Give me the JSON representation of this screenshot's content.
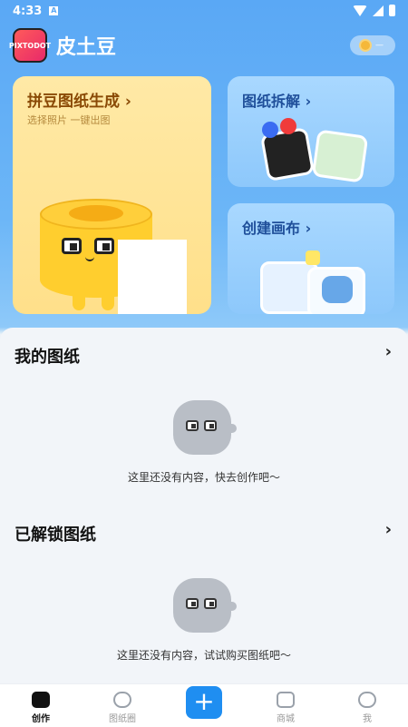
{
  "status_bar": {
    "time": "4:33",
    "sim_label": "A"
  },
  "header": {
    "logo_text_line1": "PIX",
    "logo_text_line2": "TO",
    "logo_text_line3": "DOT",
    "title": "皮土豆",
    "coin_text": "—"
  },
  "cards": {
    "generate": {
      "title": "拼豆图纸生成 ›",
      "subtitle": "选择照片 一键出图"
    },
    "disassemble": {
      "title": "图纸拆解 ›"
    },
    "create_canvas": {
      "title": "创建画布 ›"
    }
  },
  "my_drawings": {
    "title": "我的图纸",
    "chevron": "›",
    "empty_text": "这里还没有内容，快去创作吧～"
  },
  "unlocked_drawings": {
    "title": "已解锁图纸",
    "chevron": "›",
    "empty_text": "这里还没有内容，试试购买图纸吧～"
  },
  "tabbar": {
    "tabs": [
      {
        "label": "创作",
        "icon": "create-icon",
        "active": true
      },
      {
        "label": "图纸圈",
        "icon": "community-icon",
        "active": false
      },
      {
        "label": "+",
        "icon": "add-icon",
        "active": false
      },
      {
        "label": "商城",
        "icon": "shop-bag-icon",
        "active": false
      },
      {
        "label": "我",
        "icon": "profile-icon",
        "active": false
      }
    ]
  },
  "colors": {
    "accent": "#1f8ef1",
    "header_bg": "#5aa8f5",
    "big_card_bg": "#ffe08a",
    "small_card_bg": "#a9d8ff"
  }
}
